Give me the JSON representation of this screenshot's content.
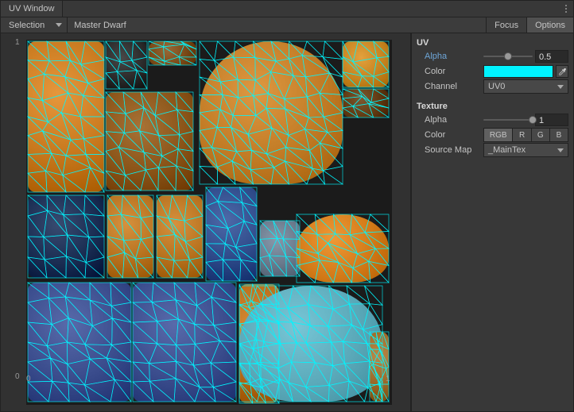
{
  "window": {
    "title": "UV Window"
  },
  "toolbar": {
    "mode": "Selection",
    "object_name": "Master Dwarf",
    "focus": "Focus",
    "options": "Options"
  },
  "viewport": {
    "axis": {
      "min": "0",
      "max": "1"
    },
    "uv_overlay_color": "#00f7ff",
    "texture_name": "_MainTex",
    "islands": [
      {
        "l": 2,
        "t": 2,
        "w": 96,
        "h": 190,
        "hue": "#c8791e"
      },
      {
        "l": 100,
        "t": 2,
        "w": 52,
        "h": 60,
        "hue": "#2a2a2a"
      },
      {
        "l": 154,
        "t": 2,
        "w": 60,
        "h": 30,
        "hue": "#7a4a18"
      },
      {
        "l": 218,
        "t": 2,
        "w": 180,
        "h": 180,
        "hue": "#c07a24",
        "round": true
      },
      {
        "l": 398,
        "t": 2,
        "w": 58,
        "h": 58,
        "hue": "#c5831f"
      },
      {
        "l": 398,
        "t": 62,
        "w": 58,
        "h": 36,
        "hue": "#603a12"
      },
      {
        "l": 100,
        "t": 66,
        "w": 110,
        "h": 124,
        "hue": "#8a5418"
      },
      {
        "l": 2,
        "t": 196,
        "w": 96,
        "h": 104,
        "hue": "#1a2d52"
      },
      {
        "l": 102,
        "t": 196,
        "w": 58,
        "h": 104,
        "hue": "#b87320"
      },
      {
        "l": 164,
        "t": 196,
        "w": 58,
        "h": 104,
        "hue": "#b87320"
      },
      {
        "l": 226,
        "t": 186,
        "w": 64,
        "h": 118,
        "hue": "#2f4b8a"
      },
      {
        "l": 294,
        "t": 228,
        "w": 50,
        "h": 70,
        "hue": "#6a7a8c"
      },
      {
        "l": 340,
        "t": 220,
        "w": 116,
        "h": 86,
        "hue": "#d27a18",
        "round": true
      },
      {
        "l": 2,
        "t": 306,
        "w": 130,
        "h": 150,
        "hue": "#3a4c8c"
      },
      {
        "l": 134,
        "t": 306,
        "w": 130,
        "h": 150,
        "hue": "#3a4c8c"
      },
      {
        "l": 268,
        "t": 308,
        "w": 50,
        "h": 150,
        "hue": "#ba6e1a"
      },
      {
        "l": 268,
        "t": 310,
        "w": 180,
        "h": 146,
        "hue": "#5aa8b8",
        "round": true
      },
      {
        "l": 432,
        "t": 368,
        "w": 24,
        "h": 88,
        "hue": "#9c6a2a"
      }
    ],
    "uv_cells": 9
  },
  "sidebar": {
    "uv": {
      "heading": "UV",
      "alpha": {
        "label": "Alpha",
        "value": "0.5",
        "pos": 0.5
      },
      "color": {
        "label": "Color",
        "hex": "#00f3ff"
      },
      "channel": {
        "label": "Channel",
        "value": "UV0"
      }
    },
    "texture": {
      "heading": "Texture",
      "alpha": {
        "label": "Alpha",
        "value": "1",
        "pos": 1.0
      },
      "color": {
        "label": "Color",
        "options": [
          "RGB",
          "R",
          "G",
          "B"
        ],
        "selected": "RGB"
      },
      "source_map": {
        "label": "Source Map",
        "value": "_MainTex"
      }
    }
  }
}
